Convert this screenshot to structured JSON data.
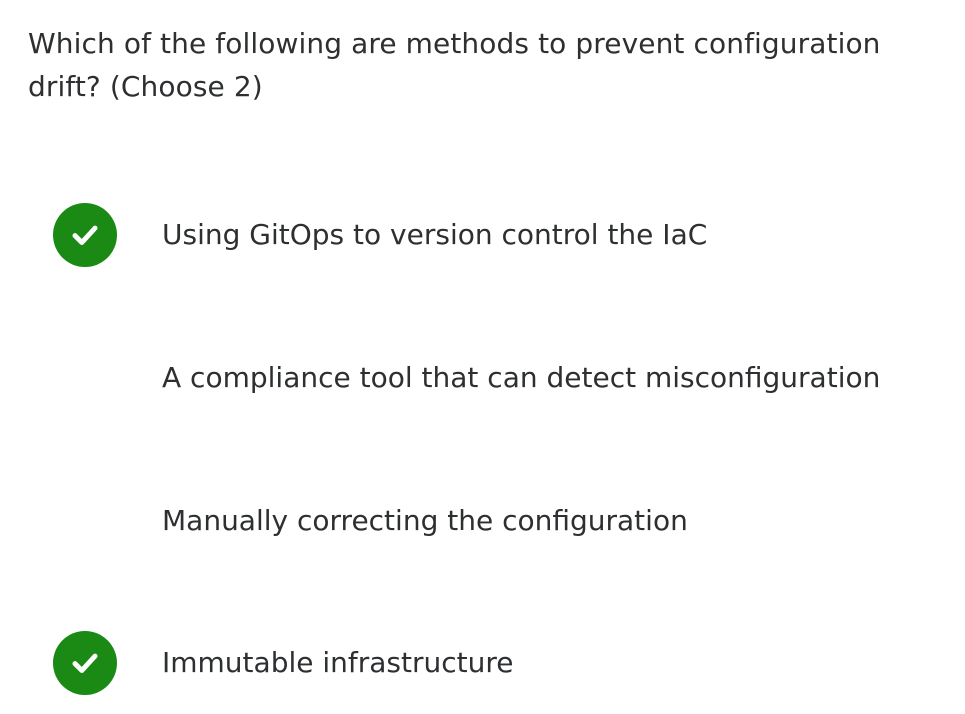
{
  "question": {
    "text": "Which of the following are methods to prevent configuration drift? (Choose 2)"
  },
  "answers": [
    {
      "text": "Using GitOps to version control the IaC",
      "selected": true,
      "icon": "check-icon"
    },
    {
      "text": "A compliance tool that can detect misconfiguration",
      "selected": false
    },
    {
      "text": "Manually correcting the configuration",
      "selected": false
    },
    {
      "text": "Immutable infrastructure",
      "selected": true,
      "icon": "check-icon"
    }
  ],
  "colors": {
    "correct": "#1a8a14",
    "text": "#2d2f31",
    "background": "#ffffff"
  }
}
